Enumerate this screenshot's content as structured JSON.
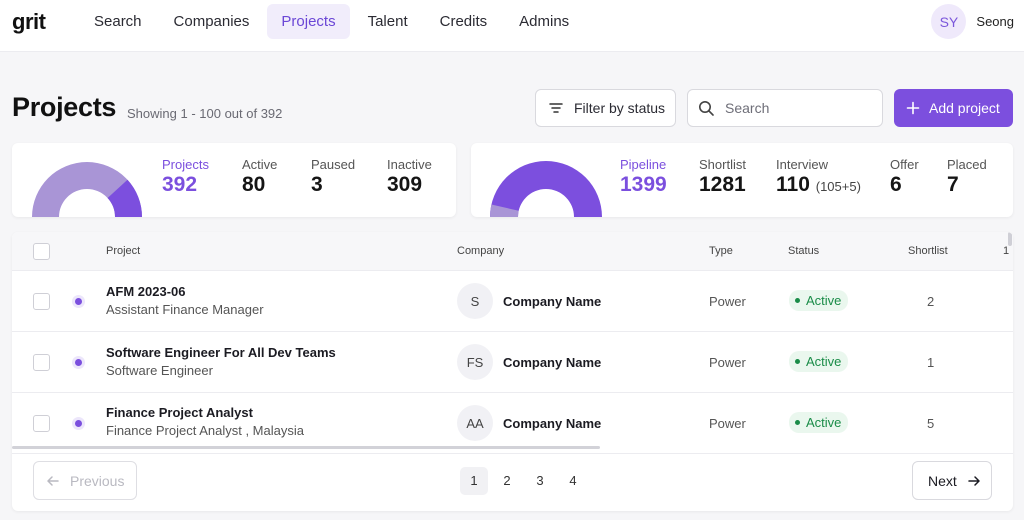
{
  "nav": {
    "logo": "grit",
    "items": [
      {
        "label": "Search"
      },
      {
        "label": "Companies"
      },
      {
        "label": "Projects",
        "active": true
      },
      {
        "label": "Talent"
      },
      {
        "label": "Credits"
      },
      {
        "label": "Admins"
      }
    ],
    "user": {
      "initials": "SY",
      "name": "Seong"
    }
  },
  "header": {
    "title": "Projects",
    "showing": "Showing 1 - 100 out of 392",
    "filter_label": "Filter by status",
    "search_placeholder": "Search",
    "add_label": "Add project"
  },
  "project_stats": {
    "items": [
      {
        "label": "Projects",
        "value": "392"
      },
      {
        "label": "Active",
        "value": "80"
      },
      {
        "label": "Paused",
        "value": "3"
      },
      {
        "label": "Inactive",
        "value": "309"
      }
    ]
  },
  "pipeline_stats": {
    "items": [
      {
        "label": "Pipeline",
        "value": "1399"
      },
      {
        "label": "Shortlist",
        "value": "1281"
      },
      {
        "label": "Interview",
        "value": "110",
        "sub": "(105+5)"
      },
      {
        "label": "Offer",
        "value": "6"
      },
      {
        "label": "Placed",
        "value": "7"
      }
    ]
  },
  "table": {
    "columns": [
      "Project",
      "Company",
      "Type",
      "Status",
      "Shortlist",
      "1"
    ],
    "rows": [
      {
        "title": "AFM 2023-06",
        "subtitle": "Assistant Finance Manager",
        "company_initials": "S",
        "company": "Company Name",
        "type": "Power",
        "status": "Active",
        "shortlist": "2"
      },
      {
        "title": "Software Engineer For All Dev Teams",
        "subtitle": "Software Engineer",
        "company_initials": "FS",
        "company": "Company Name",
        "type": "Power",
        "status": "Active",
        "shortlist": "1"
      },
      {
        "title": "Finance Project Analyst",
        "subtitle": "Finance Project Analyst , Malaysia",
        "company_initials": "AA",
        "company": "Company Name",
        "type": "Power",
        "status": "Active",
        "shortlist": "5"
      }
    ]
  },
  "pagination": {
    "previous": "Previous",
    "next": "Next",
    "pages": [
      "1",
      "2",
      "3",
      "4"
    ],
    "current_page": "1"
  },
  "colors": {
    "accent": "#7c4fde",
    "accent_light": "#a995d6",
    "status_active": "#1a8c48"
  }
}
